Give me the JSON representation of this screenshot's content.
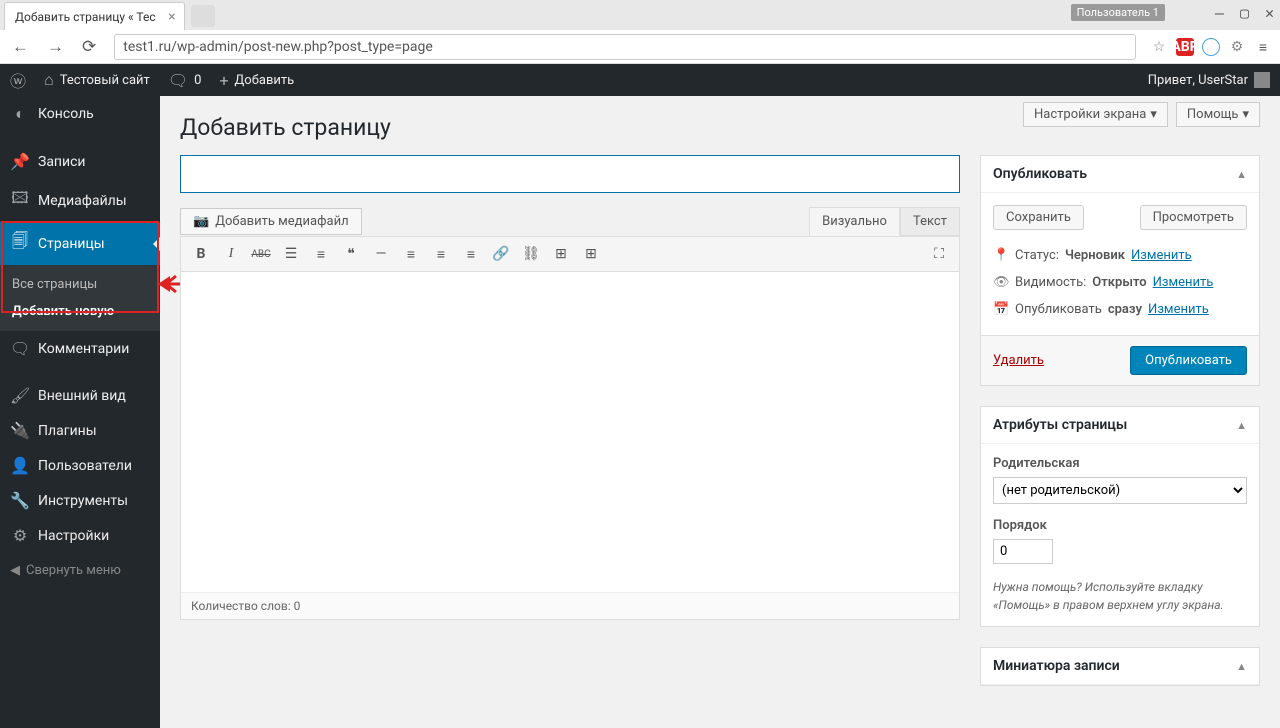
{
  "browser": {
    "tab_title": "Добавить страницу « Тес",
    "user_label": "Пользователь 1",
    "url": "test1.ru/wp-admin/post-new.php?post_type=page"
  },
  "wp_bar": {
    "site_name": "Тестовый сайт",
    "comments": "0",
    "add": "Добавить",
    "greeting": "Привет, UserStar"
  },
  "sidebar": {
    "items": [
      {
        "label": "Консоль"
      },
      {
        "label": "Записи"
      },
      {
        "label": "Медиафайлы"
      },
      {
        "label": "Страницы"
      },
      {
        "label": "Комментарии"
      },
      {
        "label": "Внешний вид"
      },
      {
        "label": "Плагины"
      },
      {
        "label": "Пользователи"
      },
      {
        "label": "Инструменты"
      },
      {
        "label": "Настройки"
      }
    ],
    "sub_all": "Все страницы",
    "sub_new": "Добавить новую",
    "collapse": "Свернуть меню"
  },
  "top": {
    "screen_options": "Настройки экрана",
    "help": "Помощь"
  },
  "page_title": "Добавить страницу",
  "editor": {
    "add_media": "Добавить медиафайл",
    "tab_visual": "Визуально",
    "tab_text": "Текст",
    "word_count": "Количество слов: 0",
    "abc_btn": "ABC"
  },
  "publish": {
    "title": "Опубликовать",
    "save": "Сохранить",
    "preview": "Просмотреть",
    "status_label": "Статус:",
    "status_value": "Черновик",
    "vis_label": "Видимость:",
    "vis_value": "Открыто",
    "pub_label": "Опубликовать",
    "pub_value": "сразу",
    "edit": "Изменить",
    "delete": "Удалить",
    "publish_btn": "Опубликовать"
  },
  "attrs": {
    "title": "Атрибуты страницы",
    "parent_label": "Родительская",
    "parent_value": "(нет родительской)",
    "order_label": "Порядок",
    "order_value": "0",
    "help": "Нужна помощь? Используйте вкладку «Помощь» в правом верхнем углу экрана."
  },
  "thumb": {
    "title": "Миниатюра записи"
  }
}
